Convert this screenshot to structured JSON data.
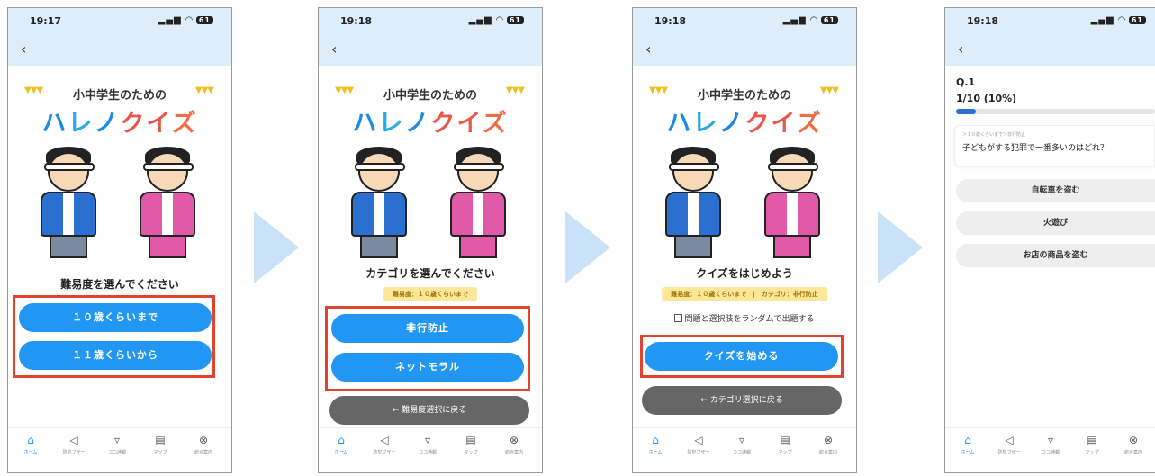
{
  "status_times": [
    "19:17",
    "19:18",
    "19:18",
    "19:18"
  ],
  "status_signal": "▂▄▆ ◠",
  "status_battery": "61",
  "back_glyph": "‹",
  "logo": {
    "subtitle": "小中学生のための",
    "title_parts": [
      "ハ",
      "レ",
      "ノ",
      "クイ",
      "ズ"
    ]
  },
  "screen1": {
    "prompt": "難易度を選んでください",
    "options": [
      "１０歳くらいまで",
      "１１歳くらいから"
    ]
  },
  "screen2": {
    "prompt": "カテゴリを選んでください",
    "badge": "難易度：１０歳くらいまで",
    "options": [
      "非行防止",
      "ネットモラル"
    ],
    "back_button": "← 難易度選択に戻る"
  },
  "screen3": {
    "prompt": "クイズをはじめよう",
    "badge": "難易度：１０歳くらいまで　|　カテゴリ：非行防止",
    "checkbox_label": "問題と選択肢をランダムで出題する",
    "start_button": "クイズを始める",
    "back_button": "← カテゴリ選択に戻る"
  },
  "screen4": {
    "question_number": "Q.1",
    "progress_text": "1/10 (10%)",
    "progress_fraction": 0.1,
    "breadcrumb": "＞１０歳くらいまで＞非行防止",
    "question": "子どもがする犯罪で一番多いのはどれ？",
    "options": [
      "自転車を盗む",
      "火遊び",
      "お店の商品を盗む"
    ]
  },
  "tabs": [
    {
      "icon": "home-icon",
      "glyph": "⌂",
      "label": "ホーム"
    },
    {
      "icon": "megaphone-icon",
      "glyph": "◁",
      "label": "防犯ブザー"
    },
    {
      "icon": "map-pin-icon",
      "glyph": "▿",
      "label": "ココ通報"
    },
    {
      "icon": "map-icon",
      "glyph": "▤",
      "label": "マップ"
    },
    {
      "icon": "info-icon",
      "glyph": "⊗",
      "label": "総合案内"
    }
  ],
  "colors": {
    "accent_blue": "#2196f3",
    "highlight_red": "#e0442e",
    "header_bg": "#ddeefa",
    "badge_yellow": "#fde89a",
    "arrow_blue": "#c9e2f7"
  }
}
